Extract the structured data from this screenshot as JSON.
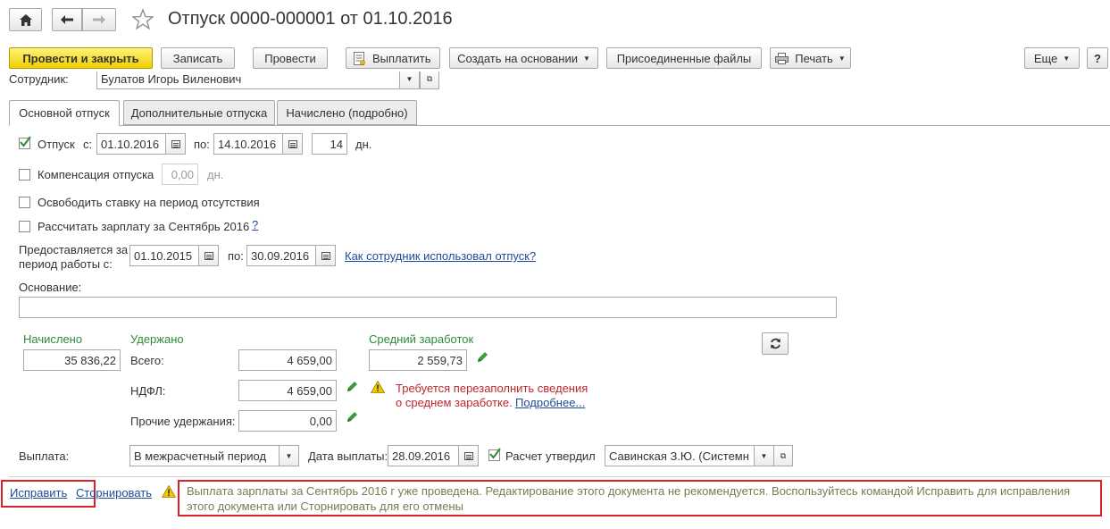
{
  "window": {
    "title": "Отпуск 0000-000001 от 01.10.2016"
  },
  "toolbar": {
    "post_and_close": "Провести и закрыть",
    "save": "Записать",
    "post": "Провести",
    "pay": "Выплатить",
    "create_based_on": "Создать на основании",
    "attached_files": "Присоединенные файлы",
    "print": "Печать",
    "more": "Еще",
    "help": "?"
  },
  "employee": {
    "label": "Сотрудник:",
    "value": "Булатов Игорь Виленович"
  },
  "tabs": [
    {
      "label": "Основной отпуск"
    },
    {
      "label": "Дополнительные отпуска"
    },
    {
      "label": "Начислено (подробно)"
    }
  ],
  "leave": {
    "label": "Отпуск",
    "from_label": "с:",
    "from": "01.10.2016",
    "to_label": "по:",
    "to": "14.10.2016",
    "days": "14",
    "days_unit": "дн.",
    "checked": true
  },
  "compensation": {
    "label": "Компенсация отпуска",
    "value": "0,00",
    "unit": "дн."
  },
  "free_rate": {
    "label": "Освободить ставку на период отсутствия"
  },
  "calc_salary": {
    "label": "Рассчитать зарплату за Сентябрь 2016",
    "help": "?"
  },
  "period": {
    "label_line1": "Предоставляется за",
    "label_line2": "период работы с:",
    "from": "01.10.2015",
    "to_label": "по:",
    "to": "30.09.2016",
    "link": "Как сотрудник использовал отпуск?"
  },
  "basis": {
    "label": "Основание:",
    "value": ""
  },
  "accrued": {
    "label": "Начислено",
    "value": "35 836,22"
  },
  "withheld": {
    "label": "Удержано",
    "total_label": "Всего:",
    "total": "4 659,00",
    "ndfl_label": "НДФЛ:",
    "ndfl": "4 659,00",
    "other_label": "Прочие удержания:",
    "other": "0,00"
  },
  "avg_earnings": {
    "label": "Средний заработок",
    "value": "2 559,73"
  },
  "warning": {
    "line1": "Требуется перезаполнить сведения",
    "line2": "о среднем заработке.",
    "link": "Подробнее..."
  },
  "payment": {
    "label": "Выплата:",
    "value": "В межрасчетный период",
    "date_label": "Дата выплаты:",
    "date": "28.09.2016",
    "approved_label": "Расчет утвердил",
    "approved_by": "Савинская З.Ю. (Системн"
  },
  "footer": {
    "fix": "Исправить",
    "reverse": "Сторнировать",
    "message": "Выплата зарплаты за Сентябрь 2016 г уже проведена. Редактирование этого документа не рекомендуется. Воспользуйтесь командой Исправить для исправления этого документа или Сторнировать для его отмены"
  },
  "colors": {
    "accent_yellow": "#f1cf00",
    "green_label": "#2e8b3a",
    "warning_red": "#c0272d",
    "link_blue": "#1f4a98",
    "highlight_box": "#d9202b"
  }
}
